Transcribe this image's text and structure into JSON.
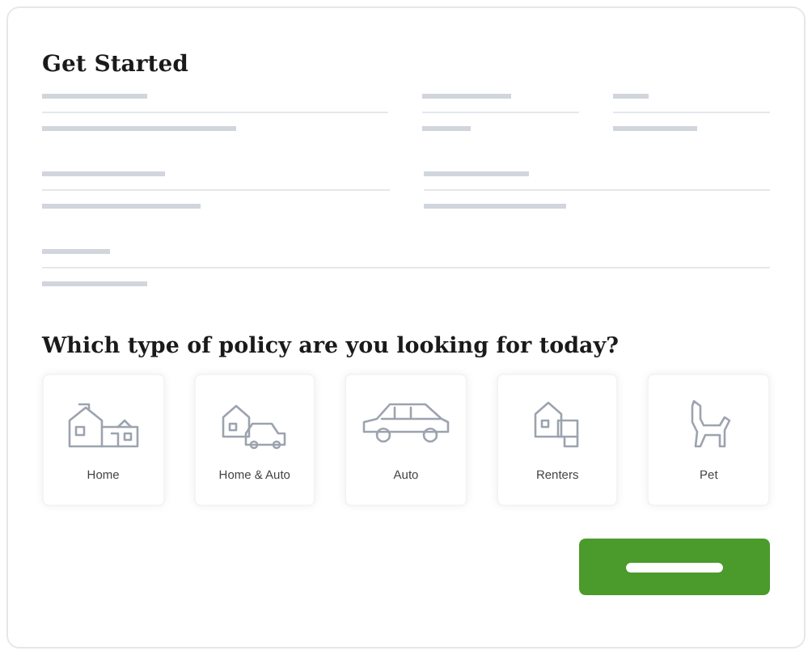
{
  "form": {
    "title": "Get Started"
  },
  "policy": {
    "question": "Which type of policy are you looking for today?",
    "options": [
      {
        "label": "Home",
        "kind": "house",
        "selected": false
      },
      {
        "label": "Home & Auto",
        "kind": "housecar",
        "selected": false
      },
      {
        "label": "Auto",
        "kind": "car",
        "selected": false
      },
      {
        "label": "Renters",
        "kind": "renters",
        "selected": false
      },
      {
        "label": "Pet",
        "kind": "pet",
        "selected": false
      }
    ]
  }
}
